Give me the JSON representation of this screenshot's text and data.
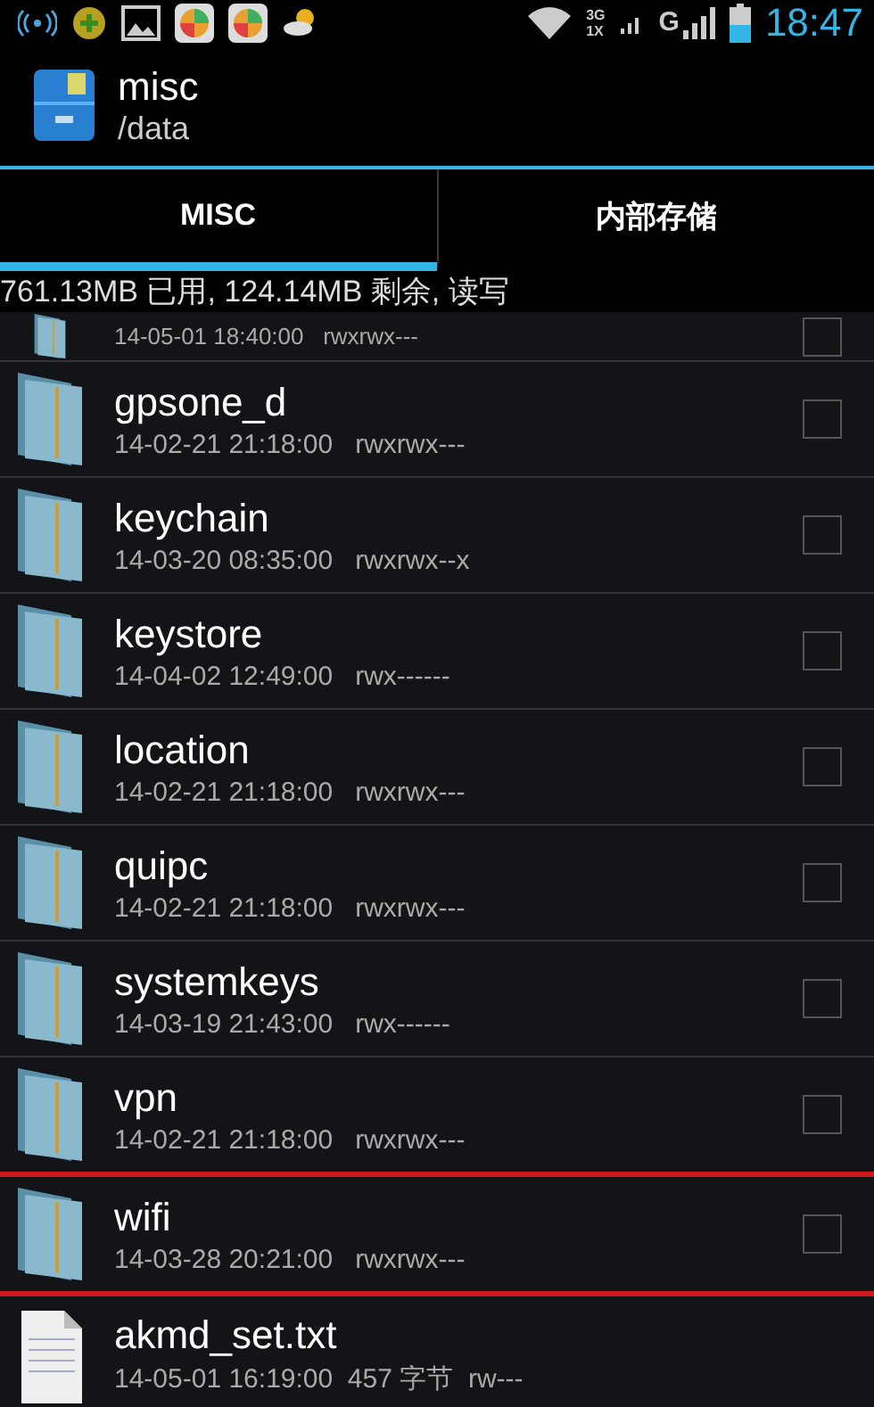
{
  "status_bar": {
    "time": "18:47",
    "network_3g": "3G",
    "network_1x": "1X",
    "network_g": "G"
  },
  "header": {
    "title": "misc",
    "path": "/data"
  },
  "tabs": [
    {
      "label": "MISC",
      "selected": true
    },
    {
      "label": "内部存储",
      "selected": false
    }
  ],
  "storage_info": "761.13MB 已用, 124.14MB 剩余, 读写",
  "files": [
    {
      "kind": "folder",
      "meta": "14-05-01 18:40:00   rwxrwx---",
      "checked": false,
      "partial": true,
      "marked": false
    },
    {
      "kind": "folder",
      "name": "gpsone_d",
      "meta": "14-02-21 21:18:00   rwxrwx---",
      "checked": false,
      "partial": false,
      "marked": false
    },
    {
      "kind": "folder",
      "name": "keychain",
      "meta": "14-03-20 08:35:00   rwxrwx--x",
      "checked": false,
      "partial": false,
      "marked": false
    },
    {
      "kind": "folder",
      "name": "keystore",
      "meta": "14-04-02 12:49:00   rwx------",
      "checked": false,
      "partial": false,
      "marked": false
    },
    {
      "kind": "folder",
      "name": "location",
      "meta": "14-02-21 21:18:00   rwxrwx---",
      "checked": false,
      "partial": false,
      "marked": false
    },
    {
      "kind": "folder",
      "name": "quipc",
      "meta": "14-02-21 21:18:00   rwxrwx---",
      "checked": false,
      "partial": false,
      "marked": false
    },
    {
      "kind": "folder",
      "name": "systemkeys",
      "meta": "14-03-19 21:43:00   rwx------",
      "checked": false,
      "partial": false,
      "marked": false
    },
    {
      "kind": "folder",
      "name": "vpn",
      "meta": "14-02-21 21:18:00   rwxrwx---",
      "checked": false,
      "partial": false,
      "marked": true
    },
    {
      "kind": "folder",
      "name": "wifi",
      "meta": "14-03-28 20:21:00   rwxrwx---",
      "checked": false,
      "partial": false,
      "marked": true
    },
    {
      "kind": "file",
      "name": "akmd_set.txt",
      "meta": "14-05-01 16:19:00  457 字节  rw---",
      "partial": false,
      "marked": false
    }
  ]
}
